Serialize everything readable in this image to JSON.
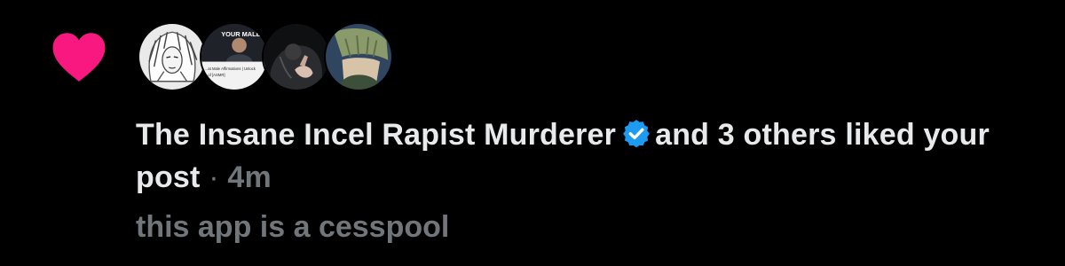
{
  "notification": {
    "type_icon": "heart-icon",
    "accent_color": "#f91880",
    "verified_color": "#1d9bf0",
    "avatars": [
      {
        "icon": "sketch-portrait-avatar"
      },
      {
        "icon": "video-thumbnail-avatar",
        "text_top": "YOUR MALE",
        "text_bottom": "...at Male Affirmations | Unlock",
        "text_bottom2": "...of [ASMR]"
      },
      {
        "icon": "dark-photo-avatar"
      },
      {
        "icon": "anime-character-avatar"
      }
    ],
    "actor_name": "The Insane Incel Rapist Murderer",
    "actor_verified": true,
    "action_text": "and 3 others liked your post",
    "separator": "·",
    "timestamp": "4m",
    "post_preview": "this app is a cesspool"
  }
}
